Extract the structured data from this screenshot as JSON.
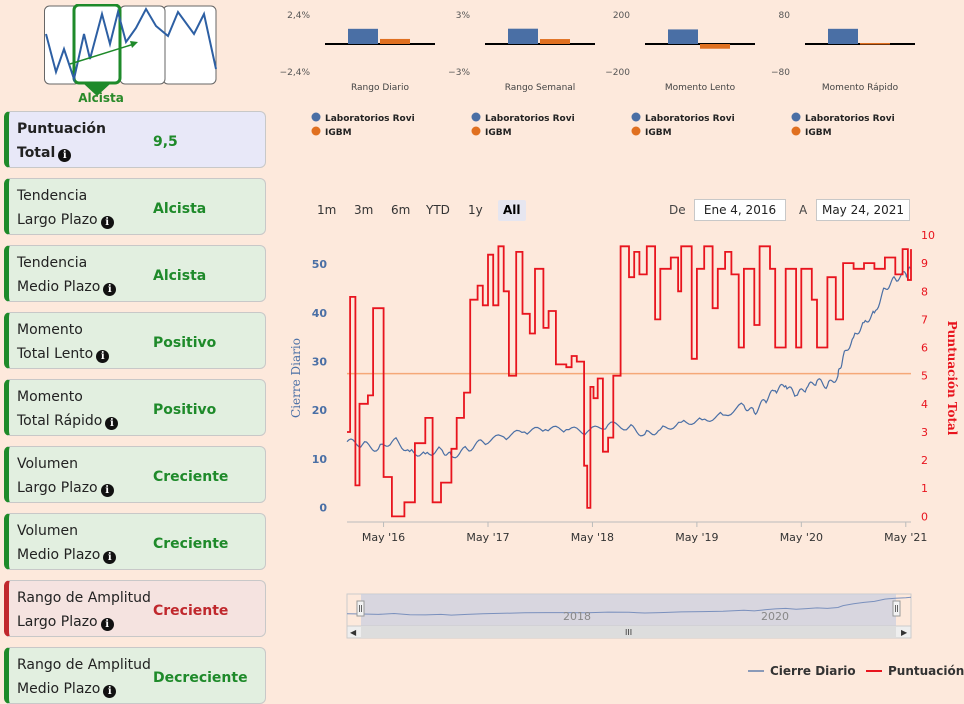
{
  "trend": {
    "label": "Alcista",
    "colors": {
      "box": "#1e8a2a",
      "line": "#2d5fa3"
    }
  },
  "cards": [
    {
      "line1": "Puntuación",
      "line2": "Total",
      "value": "9,5",
      "status": "top"
    },
    {
      "line1": "Tendencia",
      "line2": "Largo Plazo",
      "value": "Alcista",
      "status": "pos"
    },
    {
      "line1": "Tendencia",
      "line2": "Medio Plazo",
      "value": "Alcista",
      "status": "pos"
    },
    {
      "line1": "Momento",
      "line2": "Total Lento",
      "value": "Positivo",
      "status": "pos"
    },
    {
      "line1": "Momento",
      "line2": "Total Rápido",
      "value": "Positivo",
      "status": "pos"
    },
    {
      "line1": "Volumen",
      "line2": "Largo Plazo",
      "value": "Creciente",
      "status": "pos"
    },
    {
      "line1": "Volumen",
      "line2": "Medio Plazo",
      "value": "Creciente",
      "status": "pos"
    },
    {
      "line1": "Rango de Amplitud",
      "line2": "Largo Plazo",
      "value": "Creciente",
      "status": "neg"
    },
    {
      "line1": "Rango de Amplitud",
      "line2": "Medio Plazo",
      "value": "Decreciente",
      "status": "pos"
    }
  ],
  "range_selector": {
    "buttons": [
      "1m",
      "3m",
      "6m",
      "YTD",
      "1y",
      "All"
    ],
    "active": "All",
    "from_label": "De",
    "from_value": "Ene 4, 2016",
    "to_label": "A",
    "to_value": "May 24, 2021"
  },
  "colors": {
    "rovi": "#4a6fa5",
    "igbm": "#e07020",
    "close": "#4a6fa5",
    "score": "#e8141e",
    "ref": "#f5a878"
  },
  "legend_bottom": {
    "close": "Cierre Diario",
    "score": "Puntuación"
  },
  "chart_data": [
    {
      "type": "bar",
      "title": "Rango Diario",
      "categories": [
        "Rango Diario"
      ],
      "ytop": "2,4%",
      "ybottom": "−2,4%",
      "ylim": [
        -2.4,
        2.4
      ],
      "series": [
        {
          "name": "Laboratorios Rovi",
          "values": [
            1.35
          ]
        },
        {
          "name": "IGBM",
          "values": [
            0.45
          ]
        }
      ]
    },
    {
      "type": "bar",
      "title": "Rango Semanal",
      "categories": [
        "Rango Semanal"
      ],
      "ytop": "3%",
      "ybottom": "−3%",
      "ylim": [
        -3,
        3
      ],
      "series": [
        {
          "name": "Laboratorios Rovi",
          "values": [
            1.7
          ]
        },
        {
          "name": "IGBM",
          "values": [
            0.55
          ]
        }
      ]
    },
    {
      "type": "bar",
      "title": "Momento Lento",
      "categories": [
        "Momento Lento"
      ],
      "ytop": "200",
      "ybottom": "−200",
      "ylim": [
        -200,
        200
      ],
      "series": [
        {
          "name": "Laboratorios Rovi",
          "values": [
            108
          ]
        },
        {
          "name": "IGBM",
          "values": [
            -35
          ]
        }
      ]
    },
    {
      "type": "bar",
      "title": "Momento Rápido",
      "categories": [
        "Momento Rápido"
      ],
      "ytop": "80",
      "ybottom": "−80",
      "ylim": [
        -80,
        80
      ],
      "series": [
        {
          "name": "Laboratorios Rovi",
          "values": [
            45
          ]
        },
        {
          "name": "IGBM",
          "values": [
            3
          ]
        }
      ]
    },
    {
      "type": "line",
      "title": "",
      "ylabel": "Cierre Diario",
      "y2label": "Puntuación Total",
      "ylim": [
        -3,
        56
      ],
      "y2lim": [
        -0.2,
        10
      ],
      "yticks": [
        0,
        10,
        20,
        30,
        40,
        50
      ],
      "y2ticks": [
        0,
        1,
        2,
        3,
        4,
        5,
        6,
        7,
        8,
        9,
        10
      ],
      "xlim": [
        2016.0,
        2021.4
      ],
      "xticks": [
        {
          "x": 2016.35,
          "label": "May '16"
        },
        {
          "x": 2017.35,
          "label": "May '17"
        },
        {
          "x": 2018.35,
          "label": "May '18"
        },
        {
          "x": 2019.35,
          "label": "May '19"
        },
        {
          "x": 2020.35,
          "label": "May '20"
        },
        {
          "x": 2021.35,
          "label": "May '21"
        }
      ],
      "reference_line": 27.5,
      "series": [
        {
          "name": "Cierre Diario",
          "points": [
            [
              2016.0,
              13.5
            ],
            [
              2016.15,
              13
            ],
            [
              2016.3,
              12
            ],
            [
              2016.45,
              14
            ],
            [
              2016.6,
              11.5
            ],
            [
              2016.75,
              11
            ],
            [
              2016.9,
              12
            ],
            [
              2017.0,
              10.5
            ],
            [
              2017.15,
              12
            ],
            [
              2017.3,
              13.5
            ],
            [
              2017.5,
              14.5
            ],
            [
              2017.7,
              15.5
            ],
            [
              2017.9,
              16
            ],
            [
              2018.1,
              16
            ],
            [
              2018.3,
              15.5
            ],
            [
              2018.5,
              17
            ],
            [
              2018.7,
              16.5
            ],
            [
              2018.85,
              15
            ],
            [
              2019.0,
              16
            ],
            [
              2019.2,
              17.5
            ],
            [
              2019.4,
              18
            ],
            [
              2019.6,
              19
            ],
            [
              2019.8,
              21
            ],
            [
              2019.9,
              19.5
            ],
            [
              2020.0,
              22
            ],
            [
              2020.1,
              24
            ],
            [
              2020.2,
              25
            ],
            [
              2020.3,
              23
            ],
            [
              2020.4,
              24.5
            ],
            [
              2020.5,
              26
            ],
            [
              2020.6,
              25
            ],
            [
              2020.7,
              27
            ],
            [
              2020.75,
              31
            ],
            [
              2020.85,
              35
            ],
            [
              2020.95,
              38
            ],
            [
              2021.05,
              40
            ],
            [
              2021.15,
              45
            ],
            [
              2021.25,
              47
            ],
            [
              2021.35,
              48
            ],
            [
              2021.4,
              49
            ]
          ]
        },
        {
          "name": "Puntuación Total",
          "points": [
            [
              2016.0,
              3
            ],
            [
              2016.03,
              7.8
            ],
            [
              2016.08,
              1.1
            ],
            [
              2016.12,
              4
            ],
            [
              2016.2,
              4.3
            ],
            [
              2016.25,
              7.4
            ],
            [
              2016.35,
              1.4
            ],
            [
              2016.43,
              0
            ],
            [
              2016.55,
              0.5
            ],
            [
              2016.65,
              2.6
            ],
            [
              2016.75,
              3.5
            ],
            [
              2016.82,
              0.5
            ],
            [
              2016.9,
              1.2
            ],
            [
              2017.0,
              2.4
            ],
            [
              2017.05,
              3.5
            ],
            [
              2017.12,
              4.4
            ],
            [
              2017.18,
              7.7
            ],
            [
              2017.25,
              8.2
            ],
            [
              2017.3,
              7.5
            ],
            [
              2017.35,
              9.3
            ],
            [
              2017.4,
              7.5
            ],
            [
              2017.45,
              9.6
            ],
            [
              2017.5,
              8
            ],
            [
              2017.55,
              5
            ],
            [
              2017.62,
              9.4
            ],
            [
              2017.68,
              7.2
            ],
            [
              2017.75,
              6.5
            ],
            [
              2017.8,
              8.8
            ],
            [
              2017.88,
              6.7
            ],
            [
              2017.93,
              7.3
            ],
            [
              2018.0,
              5.4
            ],
            [
              2018.1,
              5.3
            ],
            [
              2018.15,
              5.7
            ],
            [
              2018.2,
              5.5
            ],
            [
              2018.27,
              1.8
            ],
            [
              2018.3,
              0.3
            ],
            [
              2018.33,
              4.6
            ],
            [
              2018.36,
              4.2
            ],
            [
              2018.4,
              4.9
            ],
            [
              2018.45,
              2.3
            ],
            [
              2018.5,
              2.8
            ],
            [
              2018.55,
              5
            ],
            [
              2018.62,
              9.6
            ],
            [
              2018.7,
              8.5
            ],
            [
              2018.75,
              9.4
            ],
            [
              2018.8,
              8.6
            ],
            [
              2018.87,
              9.6
            ],
            [
              2018.95,
              7
            ],
            [
              2019.0,
              8.8
            ],
            [
              2019.1,
              9.2
            ],
            [
              2019.17,
              8
            ],
            [
              2019.2,
              9.6
            ],
            [
              2019.3,
              5.6
            ],
            [
              2019.35,
              8.8
            ],
            [
              2019.42,
              9.6
            ],
            [
              2019.5,
              7.4
            ],
            [
              2019.55,
              8.8
            ],
            [
              2019.62,
              9.4
            ],
            [
              2019.68,
              8.6
            ],
            [
              2019.75,
              6
            ],
            [
              2019.8,
              8.8
            ],
            [
              2019.9,
              6.8
            ],
            [
              2019.95,
              9.6
            ],
            [
              2020.05,
              8.8
            ],
            [
              2020.1,
              6
            ],
            [
              2020.2,
              8.8
            ],
            [
              2020.3,
              6
            ],
            [
              2020.35,
              8.8
            ],
            [
              2020.45,
              7.7
            ],
            [
              2020.5,
              6
            ],
            [
              2020.6,
              8.5
            ],
            [
              2020.68,
              7
            ],
            [
              2020.75,
              9
            ],
            [
              2020.85,
              8.8
            ],
            [
              2020.95,
              9
            ],
            [
              2021.05,
              8.8
            ],
            [
              2021.15,
              9.2
            ],
            [
              2021.25,
              8.6
            ],
            [
              2021.32,
              9.5
            ],
            [
              2021.37,
              8.4
            ],
            [
              2021.4,
              9.5
            ]
          ]
        }
      ],
      "navigator": {
        "xticks": [
          "2018",
          "2020"
        ]
      }
    }
  ]
}
